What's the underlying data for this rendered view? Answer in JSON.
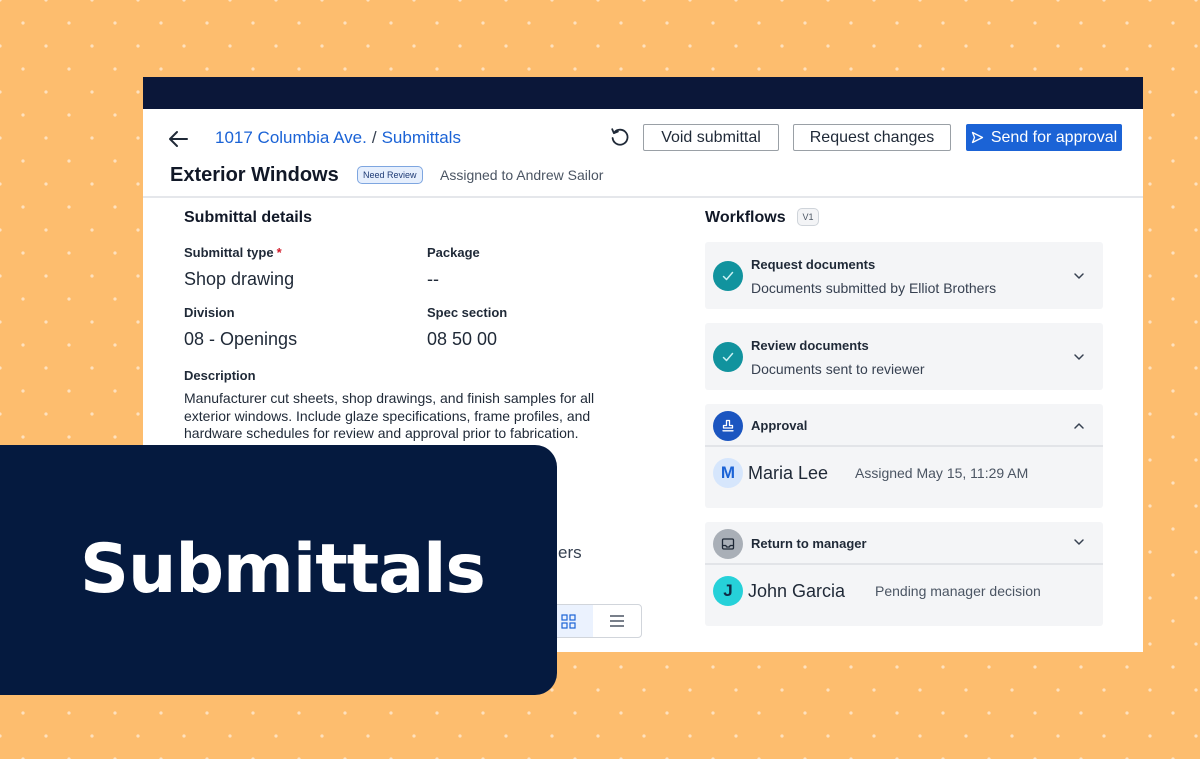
{
  "header": {
    "breadcrumb_project": "1017 Columbia Ave.",
    "breadcrumb_separator": "/",
    "breadcrumb_section": "Submittals",
    "void_label": "Void submittal",
    "request_changes_label": "Request changes",
    "send_label": "Send for approval"
  },
  "submittal": {
    "title": "Exterior Windows",
    "status_badge": "Need Review",
    "assigned": "Assigned to Andrew Sailor"
  },
  "details": {
    "section_title": "Submittal details",
    "type_label": "Submittal type",
    "required_mark": "*",
    "type_value": "Shop drawing",
    "package_label": "Package",
    "package_value": "--",
    "division_label": "Division",
    "division_value": "08 - Openings",
    "spec_label": "Spec section",
    "spec_value": "08 50 00",
    "description_label": "Description",
    "description_value": "Manufacturer cut sheets, shop drawings, and finish samples for all exterior windows. Include glaze specifications, frame profiles, and hardware schedules for review and approval prior to fabrication.",
    "partial_text": "ers"
  },
  "workflows": {
    "title": "Workflows",
    "version": "V1",
    "steps": [
      {
        "title": "Request documents",
        "subtitle": "Documents submitted by Elliot Brothers",
        "status": "complete"
      },
      {
        "title": "Review documents",
        "subtitle": "Documents sent to reviewer",
        "status": "complete"
      },
      {
        "title": "Approval",
        "status": "active",
        "expanded": true,
        "assignee_initial": "M",
        "assignee_name": "Maria Lee",
        "assignee_meta": "Assigned May 15, 11:29 AM"
      },
      {
        "title": "Return to manager",
        "status": "pending",
        "assignee_initial": "J",
        "assignee_name": "John Garcia",
        "assignee_meta": "Pending manager decision"
      }
    ]
  },
  "overlay": {
    "title": "Submittals"
  },
  "colors": {
    "background": "#FDBD6E",
    "topbar": "#0B1739",
    "link_blue": "#1B63D6",
    "teal_check": "#11939E",
    "overlay_navy": "#051A3F"
  }
}
